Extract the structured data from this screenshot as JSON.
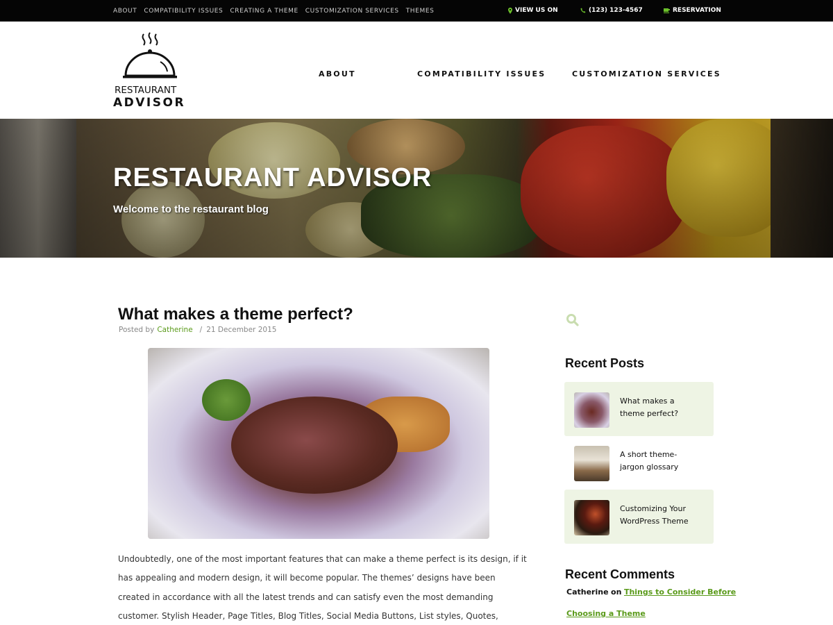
{
  "topbar": {
    "links": [
      "ABOUT",
      "COMPATIBILITY ISSUES",
      "CREATING A THEME",
      "CUSTOMIZATION SERVICES",
      "THEMES"
    ],
    "view_us_on": "VIEW US ON",
    "phone": "(123) 123-4567",
    "reservation": "RESERVATION",
    "icon_color": "#6bbf2a"
  },
  "header": {
    "logo_line1": "RESTAURANT",
    "logo_line2": "ADVISOR",
    "nav": [
      "ABOUT",
      "COMPATIBILITY ISSUES",
      "CUSTOMIZATION SERVICES"
    ]
  },
  "hero": {
    "title": "RESTAURANT ADVISOR",
    "subtitle": "Welcome to the restaurant blog"
  },
  "post": {
    "title": "What makes a theme perfect?",
    "posted_by": "Posted by",
    "author": "Catherine",
    "separator": "/",
    "date": "21 December 2015",
    "excerpt": "Undoubtedly, one of the most important features that can make a theme perfect is its design, if it has appealing and modern design, it will become popular. The themes’ designs have been created in accordance with all the latest trends and can satisfy even the most demanding customer. Stylish Header, Page Titles, Blog Titles, Social Media Buttons, List styles,  Quotes, Message Box Styles, Footer"
  },
  "sidebar": {
    "recent_posts_heading": "Recent Posts",
    "recent_posts": [
      {
        "title": "What makes a theme perfect?"
      },
      {
        "title": "A short theme-jargon glossary"
      },
      {
        "title": "Customizing Your WordPress Theme"
      }
    ],
    "recent_comments_heading": "Recent Comments",
    "comments": [
      {
        "author": "Catherine",
        "on": "on",
        "link": "Things to Consider Before"
      },
      {
        "author": "",
        "on": "",
        "link": "Choosing a Theme"
      }
    ],
    "accent_color": "#5a9a1a"
  }
}
